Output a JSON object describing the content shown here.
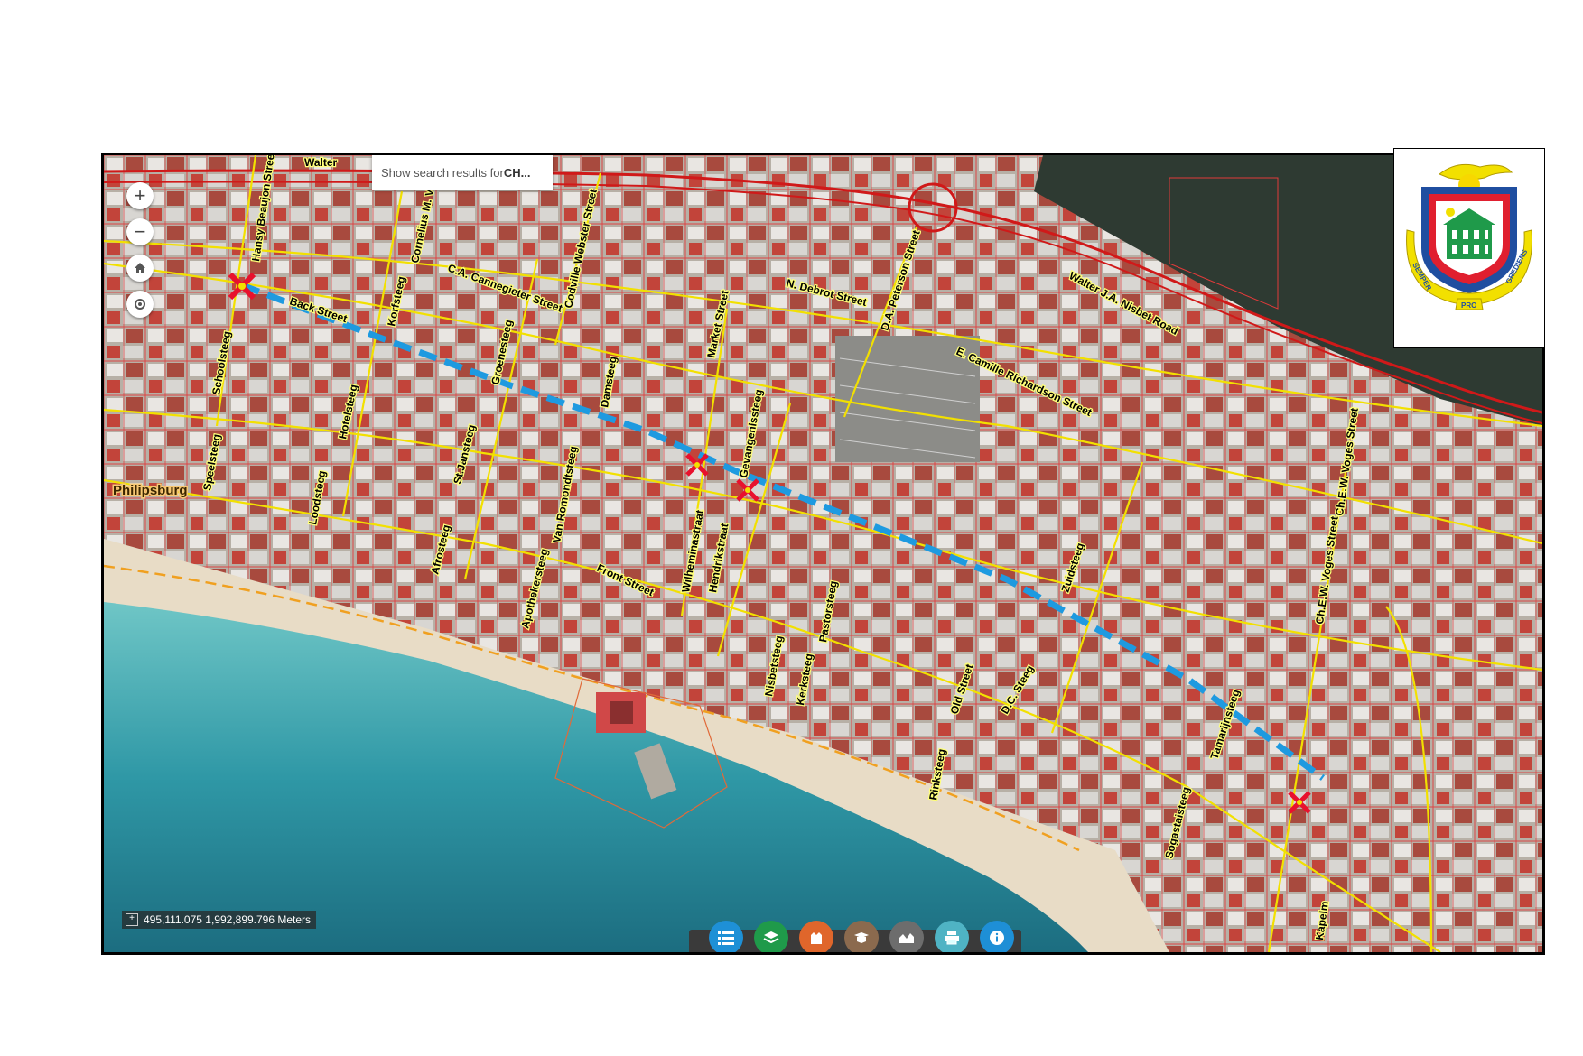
{
  "search": {
    "prefix": "Show search results for ",
    "query": "CH..."
  },
  "coordinates": {
    "value": "495,111.075 1,992,899.796 Meters"
  },
  "map": {
    "town_label": "Philipsburg",
    "streets": [
      "Hansy Beaujon Street",
      "Back Street",
      "Schoolsteeg",
      "Korfsteeg",
      "Cornelius M. Vlaun St",
      "C.A. Cannegieter Street",
      "Codville Webster Street",
      "N. Debrot Street",
      "D.A. Peterson Street",
      "Walter J.A. Nisbet Road",
      "Walter",
      "Market Street",
      "E. Camille Richardson Street",
      "Groenesteeg",
      "Damsteeg",
      "Hotelsteeg",
      "St.Jansteeg",
      "Speelsteeg",
      "Loodsteeg",
      "Van Romondtsteeg",
      "Gevangenissteeg",
      "Wilheminastraat",
      "Hendrikstraat",
      "Afrosteeg",
      "Apothekersteeg",
      "Front Street",
      "Nisbetsteeg",
      "Kerksteeg",
      "Pastorsteeg",
      "Zuidsteeg",
      "Old Street",
      "D.C. Steeg",
      "Rinksteeg",
      "Tamarijnsteeg",
      "Ch.E.W. Voges Street",
      "Ch.E.W. Voges Street",
      "Sogastaisteeg",
      "Kapelm"
    ]
  },
  "coat_of_arms": {
    "motto": [
      "SEMPER",
      "PRO",
      "GREDIENS"
    ]
  },
  "toolbar": {
    "buttons": [
      {
        "icon": "legend-list-icon",
        "color": "#1e90d6"
      },
      {
        "icon": "layers-icon",
        "color": "#1f9a4a"
      },
      {
        "icon": "basemap-icon",
        "color": "#e0662b"
      },
      {
        "icon": "bookmark-icon",
        "color": "#8b6a4e"
      },
      {
        "icon": "profile-icon",
        "color": "#6d6d6d"
      },
      {
        "icon": "print-icon",
        "color": "#4fb3c4"
      },
      {
        "icon": "info-icon",
        "color": "#1e8fd6"
      }
    ]
  },
  "colors": {
    "route": "#1e9ae0",
    "closure_marker": "#e8112d",
    "road": "#f2e000",
    "parcel": "#e03a3a",
    "walkway": "#f0a020"
  }
}
